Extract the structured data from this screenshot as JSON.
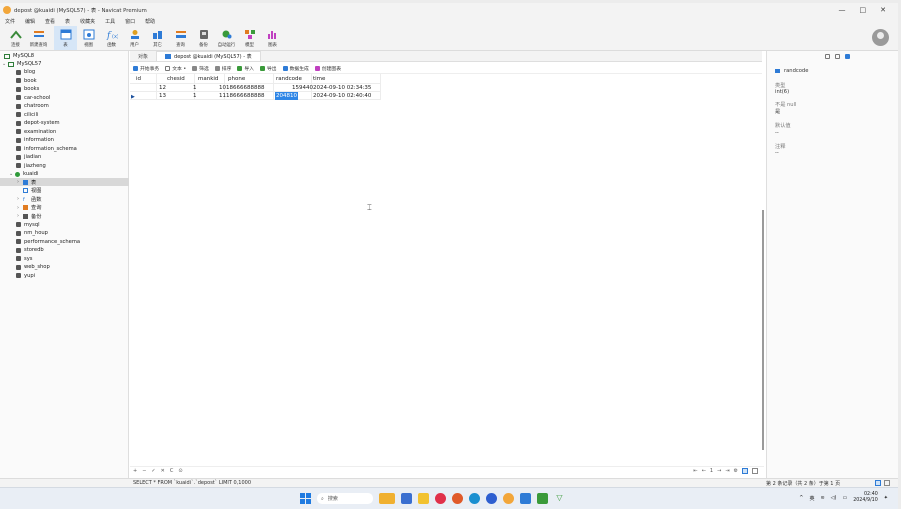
{
  "window": {
    "title": "depost @kuaidi (MySQL57) - 表 - Navicat Premium",
    "controls": [
      "—",
      "□",
      "✕"
    ]
  },
  "menu": [
    "文件",
    "编辑",
    "查看",
    "表",
    "收藏夹",
    "工具",
    "窗口",
    "帮助"
  ],
  "toolbar": [
    {
      "label": "连接",
      "icon": "connect-icon",
      "color": "#3a8a3a"
    },
    {
      "label": "新建查询",
      "icon": "new-query-icon",
      "color": "#e07b20"
    },
    {
      "label": "表",
      "icon": "table-icon",
      "color": "#2e7bd6",
      "selected": true
    },
    {
      "label": "视图",
      "icon": "view-icon",
      "color": "#2e7bd6"
    },
    {
      "label": "函数",
      "icon": "function-icon",
      "color": "#2e7bd6"
    },
    {
      "label": "用户",
      "icon": "user-icon",
      "color": "#e0a020"
    },
    {
      "label": "其它",
      "icon": "other-icon",
      "color": "#2e7bd6"
    },
    {
      "label": "查询",
      "icon": "query-icon",
      "color": "#2e7bd6"
    },
    {
      "label": "备份",
      "icon": "backup-icon",
      "color": "#555555"
    },
    {
      "label": "自动运行",
      "icon": "automation-icon",
      "color": "#3a9a3a"
    },
    {
      "label": "模型",
      "icon": "model-icon",
      "color": "#e07b20"
    },
    {
      "label": "图表",
      "icon": "chart-icon",
      "color": "#c040c0"
    }
  ],
  "navigator": {
    "connections": [
      "MySQL8",
      "MySQL57"
    ],
    "databases": [
      "blog",
      "book",
      "books",
      "car-school",
      "chatroom",
      "cilicili",
      "depot-system",
      "examination",
      "information",
      "information_schema",
      "jiadian",
      "jiazheng",
      "kuaidi"
    ],
    "kuaidi_children": [
      "表",
      "视图",
      "函数",
      "查询",
      "备份"
    ],
    "databases_after": [
      "mysql",
      "nm_houp",
      "performance_schema",
      "storedb",
      "sys",
      "web_shop",
      "yupi"
    ]
  },
  "tabs": [
    {
      "label": "对象"
    },
    {
      "label": "depost @kuaidi (MySQL57) - 表"
    }
  ],
  "sub_toolbar": [
    "开始事务",
    "文本 •",
    "筛选",
    "排序",
    "导入",
    "导出",
    "数据生成",
    "创建图表"
  ],
  "table": {
    "columns": [
      "id",
      "chesid",
      "mankid",
      "phone",
      "randcode",
      "time"
    ],
    "rows": [
      {
        "id": "12",
        "chesid": "1",
        "mankid": "10",
        "phone": "18666688888",
        "randcode": "159440",
        "time": "2024-09-10 02:34:35"
      },
      {
        "id": "13",
        "chesid": "1",
        "mankid": "11",
        "phone": "18666688888",
        "randcode": "204810",
        "time": "2024-09-10 02:40:40"
      }
    ]
  },
  "bottom_nav": {
    "buttons": [
      "+",
      "−",
      "✓",
      "✕",
      "C",
      "⊙"
    ],
    "pager": [
      "⇤",
      "←",
      "1",
      "→",
      "⇥",
      "⚙"
    ]
  },
  "statusbar": {
    "sql": "SELECT * FROM `kuaidi`.`depost` LIMIT 0,1000",
    "records": "第 2 条记录（共 2 条）于第 1 页"
  },
  "infopane": {
    "field_name": "randcode",
    "type_label": "类型",
    "type_value": "int(6)",
    "notnull_label": "不是 null",
    "notnull_value": "是",
    "default_label": "默认值",
    "default_value": "--",
    "comment_label": "注释",
    "comment_value": "--"
  },
  "taskbar": {
    "search_placeholder": "搜索",
    "lang": "英",
    "time": "02:40",
    "date": "2024/9/10"
  }
}
